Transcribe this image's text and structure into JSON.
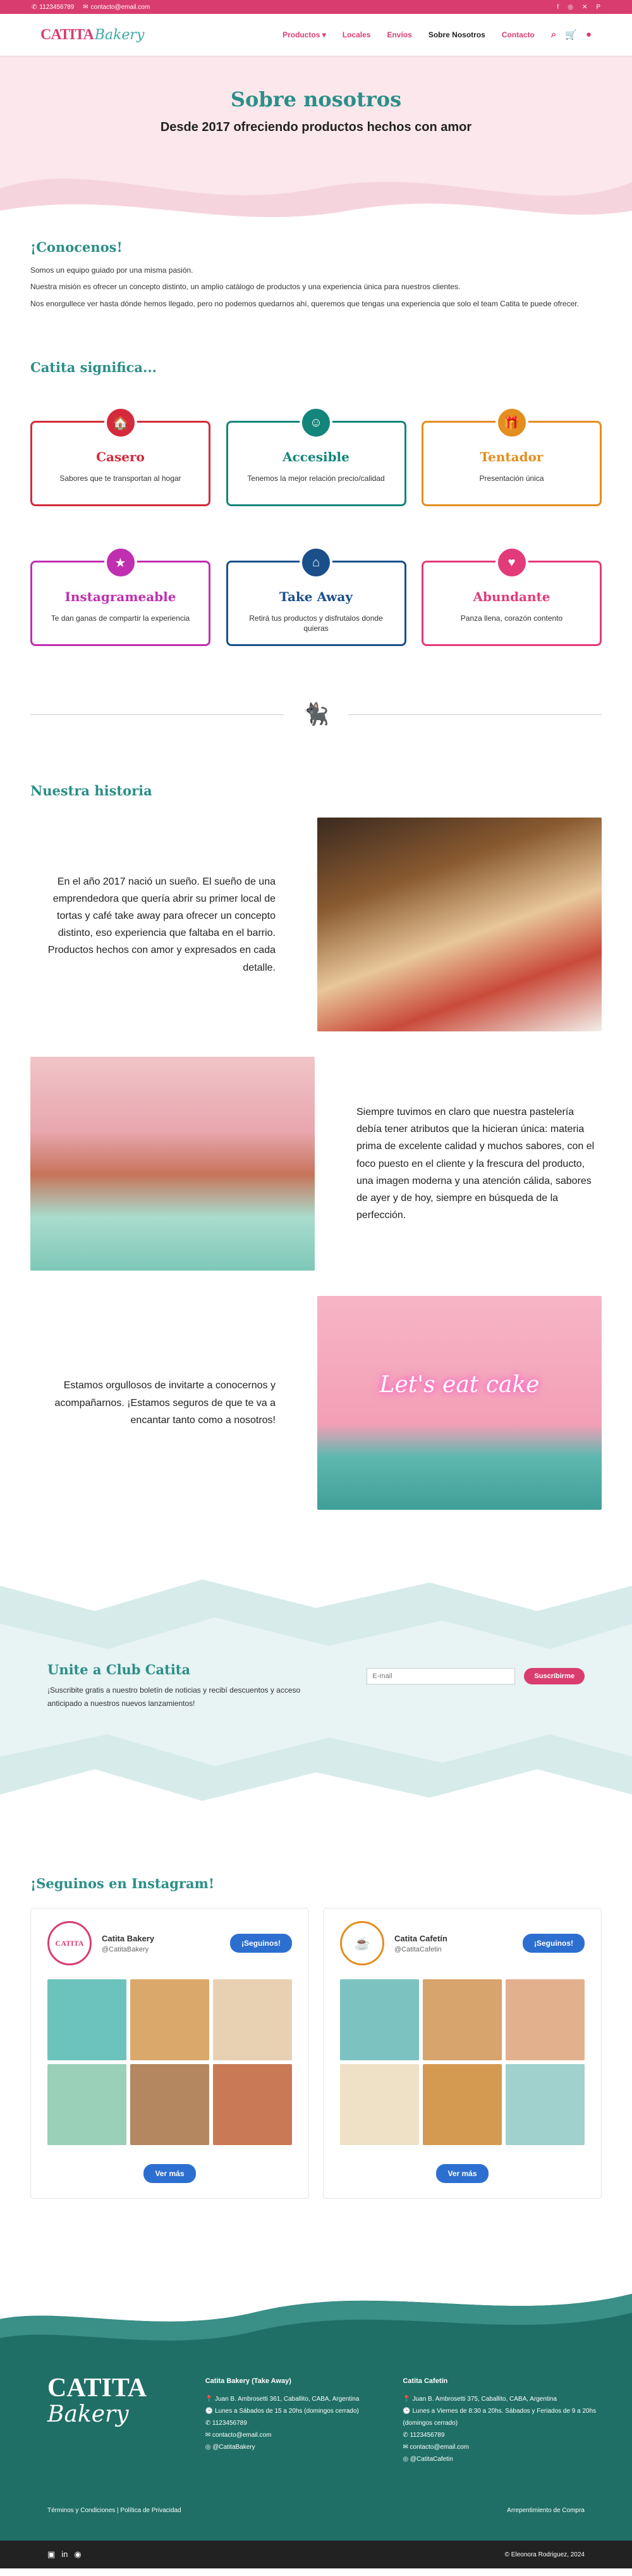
{
  "topbar": {
    "phone": "1123456789",
    "email": "contacto@email.com",
    "social": [
      "f",
      "◎",
      "✕",
      "P"
    ]
  },
  "nav": {
    "logo_a": "CATITA",
    "logo_b": "Bakery",
    "items": [
      {
        "label": "Productos ▾"
      },
      {
        "label": "Locales"
      },
      {
        "label": "Envíos"
      },
      {
        "label": "Sobre Nosotros"
      },
      {
        "label": "Contacto"
      }
    ]
  },
  "hero": {
    "title": "Sobre nosotros",
    "subtitle": "Desde 2017 ofreciendo productos hechos con amor"
  },
  "know": {
    "title": "¡Conocenos!",
    "p1": "Somos un equipo guiado por una misma pasión.",
    "p2": "Nuestra misión es ofrecer un concepto distinto, un amplio catálogo de productos y una experiencia única para nuestros clientes.",
    "p3": "Nos enorgullece ver hasta dónde hemos llegado, pero no podemos quedarnos ahí, queremos que tengas una experiencia que solo el team Catita te puede ofrecer."
  },
  "means": {
    "title": "Catita significa...",
    "cards": [
      {
        "title": "Casero",
        "text": "Sabores que te transportan al hogar",
        "color": "#d42a3c",
        "icon": "🏠"
      },
      {
        "title": "Accesible",
        "text": "Tenemos la mejor relación precio/calidad",
        "color": "#14857a",
        "icon": "☺"
      },
      {
        "title": "Tentador",
        "text": "Presentación única",
        "color": "#e38e1e",
        "icon": "🎁"
      },
      {
        "title": "Instagrameable",
        "text": "Te dan ganas de compartir la experiencia",
        "color": "#c02fb0",
        "icon": "★"
      },
      {
        "title": "Take Away",
        "text": "Retirá tus productos y disfrutalos donde quieras",
        "color": "#1a4f8a",
        "icon": "⌂"
      },
      {
        "title": "Abundante",
        "text": "Panza llena, corazón contento",
        "color": "#e33a7a",
        "icon": "♥"
      }
    ]
  },
  "story": {
    "title": "Nuestra historia",
    "r1": "En el año 2017 nació un sueño. El sueño de una emprendedora que quería abrir su primer local de tortas y café take away para ofrecer un concepto distinto, eso experiencia que faltaba en el barrio. Productos hechos con amor y expresados en cada detalle.",
    "r2": "Siempre tuvimos en claro que nuestra pastelería debía tener atributos que la hicieran única: materia prima de excelente calidad y muchos sabores, con el foco puesto en el cliente y la frescura del producto, una imagen moderna y una atención cálida, sabores de ayer y de hoy, siempre en búsqueda de la perfección.",
    "r3": "Estamos orgullosos de invitarte a conocernos y acompañarnos. ¡Estamos seguros de que te va a encantar tanto como a nosotros!",
    "neon": "Let's eat cake"
  },
  "club": {
    "title": "Unite a Club Catita",
    "text": "¡Suscribite gratis a nuestro boletín de noticias y recibí descuentos y acceso anticipado a nuestros nuevos lanzamientos!",
    "placeholder": "E-mail",
    "button": "Suscribirme"
  },
  "insta": {
    "title": "¡Seguinos en Instagram!",
    "follow": "¡Seguinos!",
    "more": "Ver más",
    "accounts": [
      {
        "name": "Catita Bakery",
        "user": "@CatitaBakery"
      },
      {
        "name": "Catita Cafetín",
        "user": "@CatitaCafetin"
      }
    ]
  },
  "footer": {
    "logo_a": "CATITA",
    "logo_b": "Bakery",
    "col1": {
      "title": "Catita Bakery (Take Away)",
      "lines": [
        "Juan B. Ambrosetti 361, Caballito, CABA, Argentina",
        "Lunes a Sábados de 15 a 20hs (domingos cerrado)",
        "1123456789",
        "contacto@email.com",
        "@CatitaBakery"
      ]
    },
    "col2": {
      "title": "Catita Cafetín",
      "lines": [
        "Juan B. Ambrosetti 375, Caballito, CABA, Argentina",
        "Lunes a Viernes de 8:30 a 20hs. Sábados y Feriados de 9 a 20hs (domingos cerrado)",
        "1123456789",
        "contacto@email.com",
        "@CatitaCafetin"
      ]
    },
    "terms": "Términos y Condiciones | Política de Privacidad",
    "arrep": "Arrepentimiento de Compra",
    "credit": "© Eleonora Rodriguez, 2024"
  }
}
